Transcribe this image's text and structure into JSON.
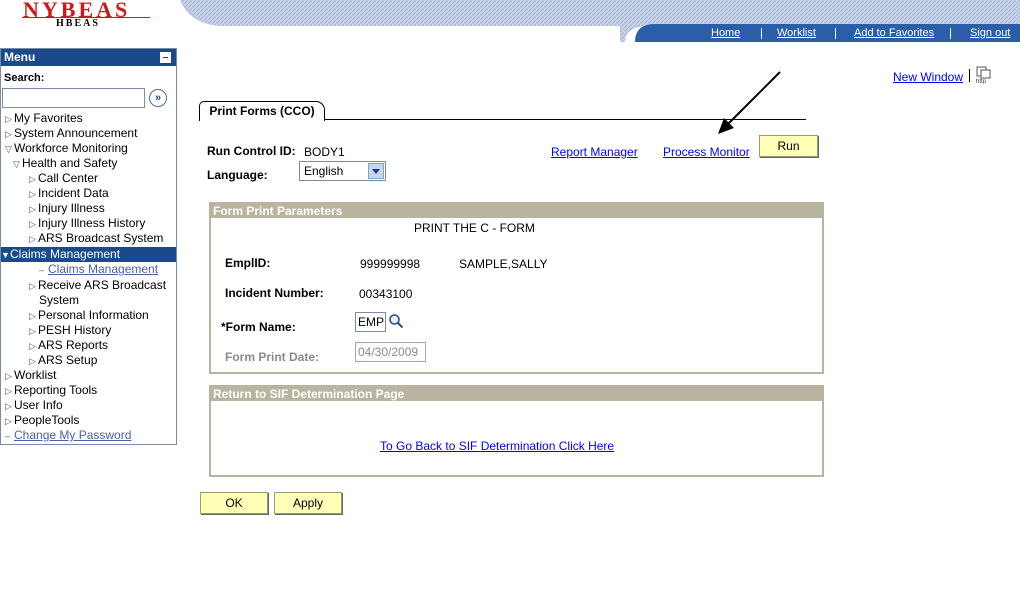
{
  "header": {
    "logo_main": "NYBEAS",
    "logo_sub": "HBEAS",
    "links": [
      "Home",
      "Worklist",
      "Add to Favorites",
      "Sign out"
    ],
    "banner_color": "#2b5ea8"
  },
  "menu": {
    "title": "Menu",
    "search_label": "Search:",
    "search_value": "",
    "items": [
      {
        "label": "My Favorites",
        "level": 0,
        "state": "collapsed"
      },
      {
        "label": "System Announcement",
        "level": 0,
        "state": "collapsed"
      },
      {
        "label": "Workforce Monitoring",
        "level": 0,
        "state": "expanded"
      },
      {
        "label": "Health and Safety",
        "level": 1,
        "state": "expanded"
      },
      {
        "label": "Call Center",
        "level": 2,
        "state": "collapsed"
      },
      {
        "label": "Incident Data",
        "level": 2,
        "state": "collapsed"
      },
      {
        "label": "Injury Illness",
        "level": 2,
        "state": "collapsed"
      },
      {
        "label": "Injury Illness History",
        "level": 2,
        "state": "collapsed"
      },
      {
        "label": "ARS Broadcast System",
        "level": 2,
        "state": "collapsed"
      },
      {
        "label": "Claims Management",
        "level": 2,
        "state": "selected"
      },
      {
        "label": "Claims Management",
        "level": 3,
        "state": "link"
      },
      {
        "label": "Receive ARS Broadcast",
        "level": 2,
        "state": "collapsed"
      },
      {
        "label": "System",
        "level": 2,
        "state": "continuation"
      },
      {
        "label": "Personal Information",
        "level": 2,
        "state": "collapsed"
      },
      {
        "label": "PESH History",
        "level": 2,
        "state": "collapsed"
      },
      {
        "label": "ARS Reports",
        "level": 2,
        "state": "collapsed"
      },
      {
        "label": "ARS Setup",
        "level": 2,
        "state": "collapsed"
      },
      {
        "label": "Worklist",
        "level": 0,
        "state": "collapsed"
      },
      {
        "label": "Reporting Tools",
        "level": 0,
        "state": "collapsed"
      },
      {
        "label": "User Info",
        "level": 0,
        "state": "collapsed"
      },
      {
        "label": "PeopleTools",
        "level": 0,
        "state": "collapsed"
      },
      {
        "label": "Change My Password",
        "level": 0,
        "state": "link"
      }
    ]
  },
  "content": {
    "new_window": "New Window",
    "tab_label": "Print Forms (CCO)",
    "run_control_label": "Run Control ID:",
    "run_control_value": "BODY1",
    "language_label": "Language:",
    "language_value": "English",
    "report_manager": "Report Manager",
    "process_monitor": "Process Monitor",
    "run_button": "Run",
    "form_params": {
      "title": "Form Print Parameters",
      "heading": "PRINT THE C - FORM",
      "emplid_label": "EmplID:",
      "emplid_value": "999999998",
      "name_value": "SAMPLE,SALLY",
      "incident_label": "Incident Number:",
      "incident_value": "00343100",
      "form_name_label": "*Form Name:",
      "form_name_value": "EMP",
      "print_date_label": "Form Print Date:",
      "print_date_value": "04/30/2009"
    },
    "return_section": {
      "title": "Return to SIF Determination Page",
      "link": "To Go Back to SIF Determination Click Here"
    },
    "ok_button": "OK",
    "apply_button": "Apply"
  }
}
